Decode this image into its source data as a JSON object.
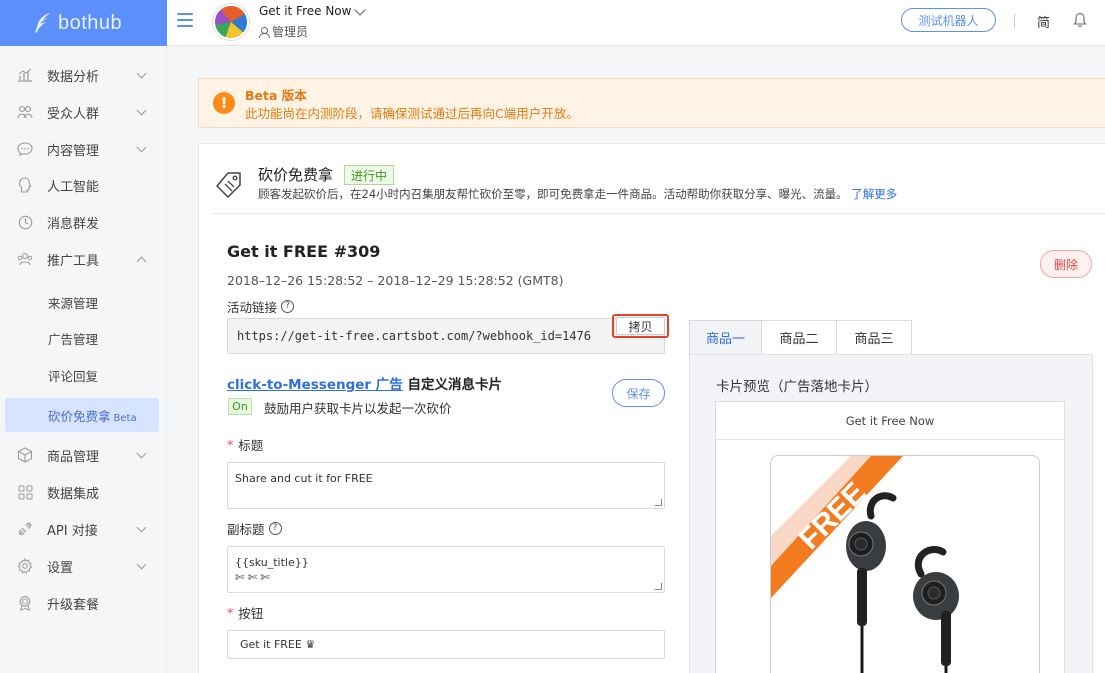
{
  "header": {
    "logo_text": "bothub",
    "store_name": "Get it Free Now",
    "role": "管理员",
    "test_bot_label": "测试机器人",
    "lang_label": "简"
  },
  "sidebar": {
    "items": [
      {
        "label": "数据分析",
        "icon": "chart-icon"
      },
      {
        "label": "受众人群",
        "icon": "users-icon"
      },
      {
        "label": "内容管理",
        "icon": "chat-icon"
      },
      {
        "label": "人工智能",
        "icon": "brain-icon"
      },
      {
        "label": "消息群发",
        "icon": "clock-icon"
      },
      {
        "label": "推广工具",
        "icon": "promo-icon"
      }
    ],
    "sub_items": [
      {
        "label": "来源管理"
      },
      {
        "label": "广告管理"
      },
      {
        "label": "评论回复"
      },
      {
        "label": "砍价免费拿",
        "badge": "Beta"
      }
    ],
    "items_after": [
      {
        "label": "商品管理",
        "icon": "box-icon"
      },
      {
        "label": "数据集成",
        "icon": "grid-icon"
      },
      {
        "label": "API 对接",
        "icon": "api-icon"
      },
      {
        "label": "设置",
        "icon": "gear-icon"
      },
      {
        "label": "升级套餐",
        "icon": "upgrade-icon"
      }
    ]
  },
  "beta_banner": {
    "title": "Beta 版本",
    "text": "此功能尚在内测阶段，请确保测试通过后再向C端用户开放。",
    "color": "#e07b12"
  },
  "feature": {
    "title": "砍价免费拿",
    "status": "进行中",
    "description": "顾客发起砍价后，在24小时内召集朋友帮忙砍价至零，即可免费拿走一件商品。活动帮助你获取分享、曝光、流量。",
    "learn_more": "了解更多"
  },
  "campaign": {
    "title": "Get it FREE #309",
    "date_range": "2018–12–26 15:28:52 – 2018–12–29 15:28:52 (GMT8)",
    "delete_label": "删除",
    "link_label": "活动链接",
    "link_url": "https://get-it-free.cartsbot.com/?webhook_id=1476",
    "copy_label": "拷贝"
  },
  "ctm": {
    "link_text": "click-to-Messenger 广告",
    "title_suffix": " 自定义消息卡片",
    "toggle_label": "On",
    "toggle_desc": "鼓励用户获取卡片以发起一次砍价",
    "save_label": "保存"
  },
  "form": {
    "title_label": "标题",
    "title_value": "Share and cut it for FREE",
    "subtitle_label": "副标题",
    "subtitle_line1": "{{sku_title}}",
    "subtitle_line2": "✄ ✄ ✄",
    "button_label": "按钮",
    "button_value": "Get it FREE ♛"
  },
  "preview": {
    "tabs": [
      "商品一",
      "商品二",
      "商品三"
    ],
    "active_tab": 0,
    "label": "卡片预览（广告落地卡片）",
    "card_title": "Get it Free Now",
    "ribbon_text": "FREE",
    "ribbon_color": "#f47c20"
  },
  "colors": {
    "brand": "#5b8ff9",
    "link": "#2f6fde",
    "danger": "#e84545",
    "success": "#3c9a1a"
  }
}
